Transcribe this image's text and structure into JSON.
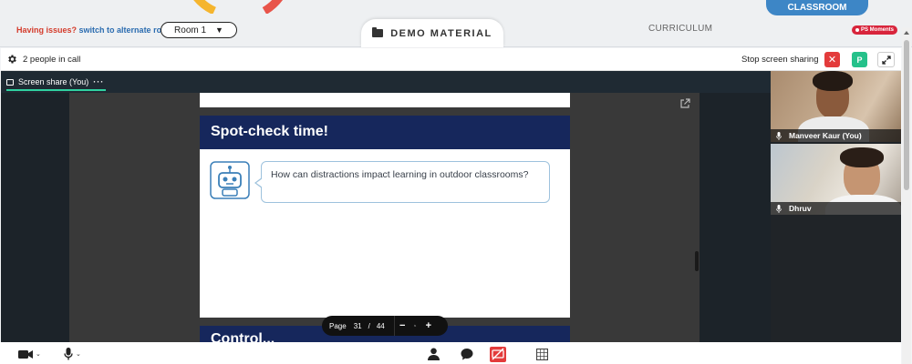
{
  "topbar": {
    "issues_prefix": "Having issues?",
    "alt_room_link": "switch to alternate room",
    "room_select_value": "Room 1",
    "demo_tab_label": "DEMO MATERIAL",
    "curriculum_label": "CURRICULUM",
    "classroom_tab_label": "CLASSROOM",
    "ps_badge_label": "PS Moments"
  },
  "call": {
    "people_count_label": "2 people in call",
    "stop_share_label": "Stop screen sharing",
    "p_button_label": "P",
    "x_button_label": "✕",
    "share_tab_label": "Screen share (You)",
    "share_tab_menu": "···"
  },
  "slide": {
    "title": "Spot-check time!",
    "question": "How can distractions impact learning in outdoor classrooms?",
    "next_title": "Control..."
  },
  "pager": {
    "label": "Page",
    "current": "31",
    "separator": "/",
    "total": "44",
    "minus": "−",
    "plus": "+"
  },
  "participants": [
    {
      "name": "Manveer Kaur (You)"
    },
    {
      "name": "Dhruv"
    }
  ],
  "colors": {
    "slide_header": "#16275c",
    "accent_green": "#30d2a0",
    "classroom_blue": "#3d86c6",
    "danger_red": "#e33b3b"
  }
}
